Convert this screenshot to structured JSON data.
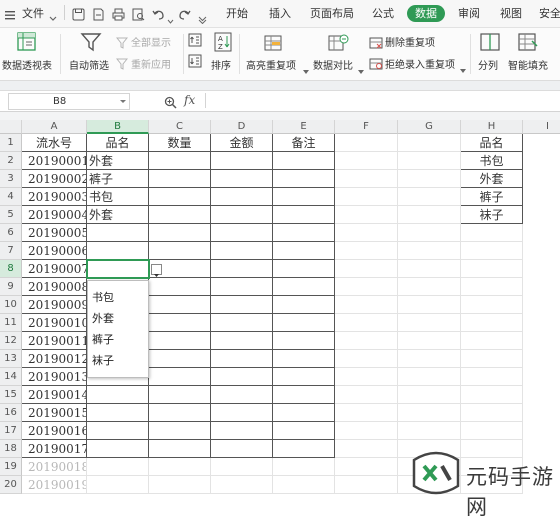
{
  "menu": {
    "file": "文件",
    "tabs": [
      "开始",
      "插入",
      "页面布局",
      "公式",
      "数据",
      "审阅",
      "视图",
      "安全"
    ],
    "active_tab": "数据"
  },
  "ribbon": {
    "pivot": "数据透视表",
    "autofilter": "自动筛选",
    "show_all": "全部显示",
    "reapply": "重新应用",
    "sort": "排序",
    "highlight_dup": "高亮重复项",
    "data_compare": "数据对比",
    "remove_dup": "删除重复项",
    "reject_dup": "拒绝录入重复项",
    "split": "分列",
    "smart_fill": "智能填充"
  },
  "formula_bar": {
    "name_box": "B8",
    "fx": "fx",
    "zoom_icon": "search-icon"
  },
  "grid": {
    "columns": [
      "A",
      "B",
      "C",
      "D",
      "E",
      "F",
      "G",
      "H",
      "I"
    ],
    "selected_column": "B",
    "selected_row": "8",
    "rows": [
      {
        "num": "1",
        "a": "流水号",
        "b": "品名",
        "c": "数量",
        "d": "金额",
        "e": "备注",
        "h": "品名"
      },
      {
        "num": "2",
        "a": "20190001",
        "b": "外套",
        "h": "书包"
      },
      {
        "num": "3",
        "a": "20190002",
        "b": "裤子",
        "h": "外套"
      },
      {
        "num": "4",
        "a": "20190003",
        "b": "书包",
        "h": "裤子"
      },
      {
        "num": "5",
        "a": "20190004",
        "b": "外套",
        "h": "袜子"
      },
      {
        "num": "6",
        "a": "20190005"
      },
      {
        "num": "7",
        "a": "20190006"
      },
      {
        "num": "8",
        "a": "20190007"
      },
      {
        "num": "9",
        "a": "20190008"
      },
      {
        "num": "10",
        "a": "20190009"
      },
      {
        "num": "11",
        "a": "20190010"
      },
      {
        "num": "12",
        "a": "20190011"
      },
      {
        "num": "13",
        "a": "20190012"
      },
      {
        "num": "14",
        "a": "20190013"
      },
      {
        "num": "15",
        "a": "20190014"
      },
      {
        "num": "16",
        "a": "20190015"
      },
      {
        "num": "17",
        "a": "20190016"
      },
      {
        "num": "18",
        "a": "20190017"
      },
      {
        "num": "19",
        "a": "20190018"
      },
      {
        "num": "20",
        "a": "20190019"
      }
    ]
  },
  "dropdown": {
    "options": [
      "书包",
      "外套",
      "裤子",
      "袜子"
    ]
  },
  "watermark": {
    "text": "元码手游网"
  },
  "colors": {
    "accent": "#2f9a55"
  }
}
